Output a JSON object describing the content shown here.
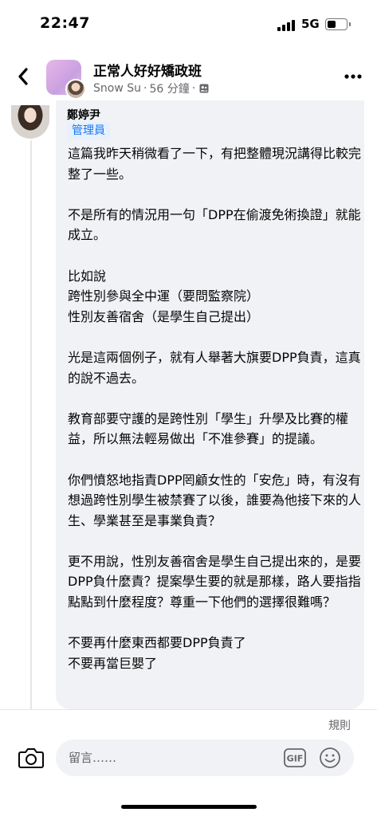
{
  "status_bar": {
    "time": "22:47",
    "network": "5G"
  },
  "header": {
    "group_name": "正常人好好矯政班",
    "poster": "Snow Su",
    "dot": "·",
    "time_ago": "56 分鐘",
    "dot2": "·"
  },
  "comment": {
    "author": "鄭婷尹",
    "badge": "管理員",
    "paragraphs": [
      "這篇我昨天稍微看了一下，有把整體現況講得比較完整了一些。",
      "不是所有的情況用一句「DPP在偷渡免術換證」就能成立。",
      "比如說\n跨性別參與全中運（要問監察院）\n性別友善宿舍（是學生自己提出）",
      "光是這兩個例子，就有人舉著大旗要DPP負責，這真的說不過去。",
      "教育部要守護的是跨性別「學生」升學及比賽的權益，所以無法輕易做出「不准參賽」的提議。",
      "你們憤怒地指責DPP罔顧女性的「安危」時，有沒有想過跨性別學生被禁賽了以後，誰要為他接下來的人生、學業甚至是事業負責？",
      "更不用說，性別友善宿舍是學生自己提出來的，是要DPP負什麼責？提案學生要的就是那樣，路人要指指點點到什麼程度？尊重一下他們的選擇很難嗎？",
      "不要再什麼東西都要DPP負責了\n不要再當巨嬰了"
    ]
  },
  "composer": {
    "rules": "規則",
    "placeholder": "留言……",
    "gif_label": "GIF"
  },
  "icons": {
    "back": "chevron-left-icon",
    "more": "more-icon",
    "privacy": "members-icon",
    "camera": "camera-icon",
    "gif": "gif-icon",
    "emoji": "emoji-icon"
  },
  "colors": {
    "accent": "#1877f2",
    "bubble": "#f0f2f5",
    "secondary_text": "#65676b"
  }
}
